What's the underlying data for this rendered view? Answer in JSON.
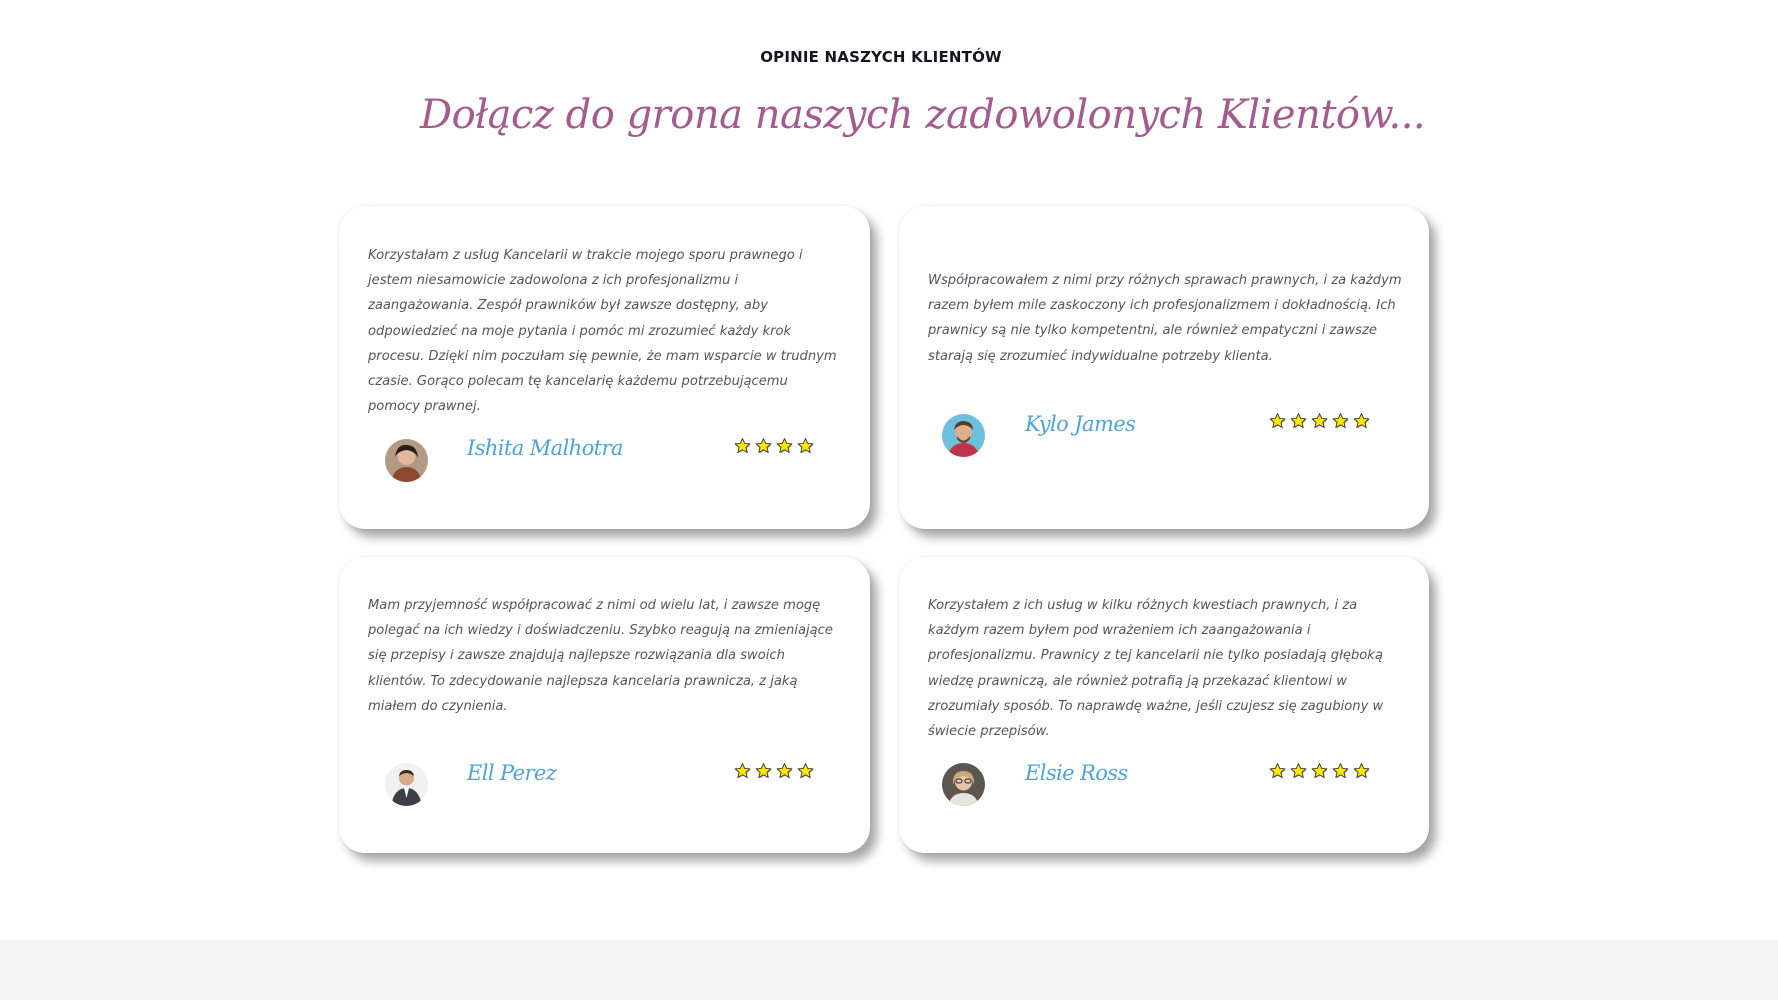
{
  "section": {
    "eyebrow": "OPINIE NASZYCH KLIENTÓW",
    "heading": "Dołącz do grona naszych zadowolonych Klientów..."
  },
  "testimonials": [
    {
      "quote": "Korzystałam z usług Kancelarii w trakcie mojego sporu prawnego i jestem niesamowicie zadowolona z ich profesjonalizmu i zaangażowania. Zespół prawników był zawsze dostępny, aby odpowiedzieć na moje pytania i pomóc mi zrozumieć każdy krok procesu. Dzięki nim poczułam się pewnie, że mam wsparcie w trudnym czasie. Gorąco polecam tę kancelarię każdemu potrzebującemu pomocy prawnej.",
      "author": "Ishita Malhotra",
      "rating": 4
    },
    {
      "quote": "Współpracowałem z nimi przy różnych sprawach prawnych, i za każdym razem byłem mile zaskoczony ich profesjonalizmem i dokładnością. Ich prawnicy są nie tylko kompetentni, ale również empatyczni i zawsze starają się zrozumieć indywidualne potrzeby klienta.",
      "author": "Kylo James",
      "rating": 5
    },
    {
      "quote": "Mam przyjemność współpracować z nimi od wielu lat, i zawsze mogę polegać na ich wiedzy i doświadczeniu. Szybko reagują na zmieniające się przepisy i zawsze znajdują najlepsze rozwiązania dla swoich klientów. To zdecydowanie najlepsza kancelaria prawnicza, z jaką miałem do czynienia.",
      "author": "Ell Perez",
      "rating": 4
    },
    {
      "quote": "Korzystałem z ich usług w kilku różnych kwestiach prawnych, i za każdym razem byłem pod wrażeniem ich zaangażowania i profesjonalizmu. Prawnicy z tej kancelarii nie tylko posiadają głęboką wiedzę prawniczą, ale również potrafią ją przekazać klientowi w zrozumiały sposób. To naprawdę ważne, jeśli czujesz się zagubiony w świecie przepisów.",
      "author": "Elsie Ross",
      "rating": 5
    }
  ],
  "colors": {
    "heading": "#a45b8d",
    "author": "#4fa3d7",
    "star_fill": "#ffe600",
    "star_stroke": "#3a3a3a",
    "footer_band": "#f3f3f3"
  },
  "icons": {
    "rating_star": "star-icon",
    "avatar": "avatar-image"
  }
}
